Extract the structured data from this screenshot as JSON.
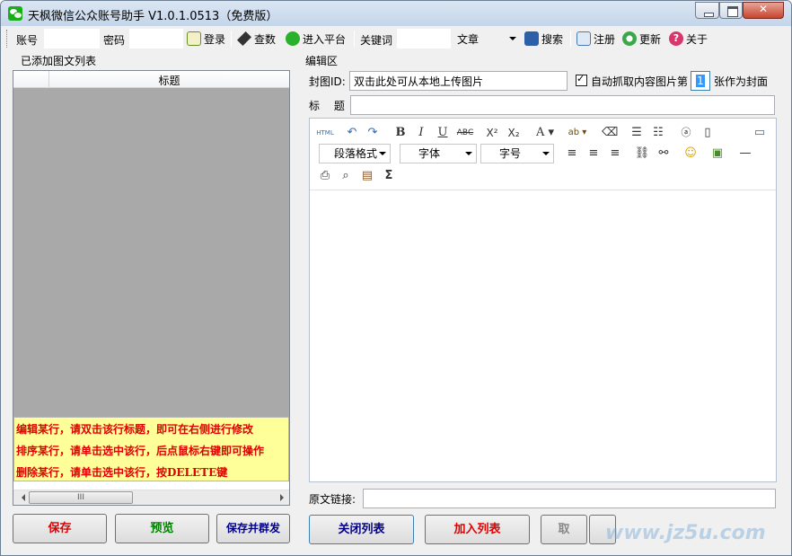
{
  "window": {
    "title": "天枫微信公众账号助手 V1.0.1.0513（免费版）"
  },
  "toolbar": {
    "account_label": "账号",
    "account_value": "",
    "password_label": "密码",
    "password_value": "",
    "login_label": "登录",
    "check_count_label": "查数",
    "enter_platform_label": "进入平台",
    "keyword_label": "关键词",
    "keyword_value": "",
    "type_selected": "文章",
    "search_label": "搜索",
    "register_label": "注册",
    "update_label": "更新",
    "about_label": "关于"
  },
  "left_panel": {
    "group_label": "已添加图文列表",
    "columns": [
      "",
      "标题"
    ],
    "rows": [],
    "tips": [
      "编辑某行，请双击该行标题，即可在右侧进行修改",
      "排序某行，请单击选中该行，后点鼠标右键即可操作",
      "删除某行，请单击选中该行，按DELETE键"
    ],
    "scroll_thumb_text": "III",
    "save_label": "保存",
    "preview_label": "预览",
    "save_send_label": "保存并群发"
  },
  "right_panel": {
    "group_label": "编辑区",
    "cover_label": "封图ID:",
    "cover_value": "双击此处可从本地上传图片",
    "auto_grab_label": "自动抓取内容图片第",
    "auto_grab_checked": true,
    "cover_index": "1",
    "cover_suffix": "张作为封面",
    "title_label": "标 题:",
    "title_value": "",
    "editor": {
      "html_label": "HTML",
      "paragraph_select": "段落格式",
      "font_select": "字体",
      "size_select": "字号",
      "content": ""
    },
    "source_label": "原文链接:",
    "source_value": "",
    "close_list_label": "关闭列表",
    "add_list_label": "加入列表",
    "cancel_label": "取"
  },
  "watermark": "www.jz5u.com",
  "colors": {
    "accent_red": "#e00000",
    "accent_green": "#008000",
    "accent_navy": "#00008b",
    "tips_background": "#ffff99",
    "list_background": "#a9a9a9"
  }
}
